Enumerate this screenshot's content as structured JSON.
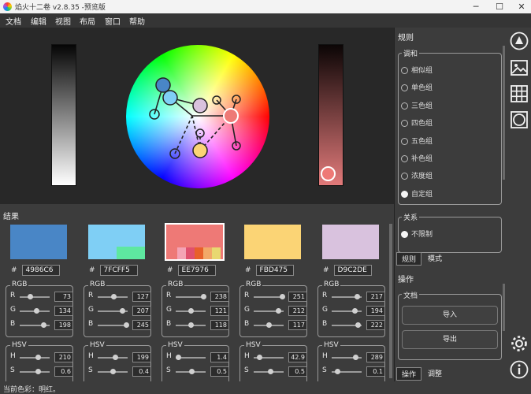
{
  "window": {
    "title": "焰火十二卷 v2.8.35 -预览版",
    "minimize": "─",
    "maximize": "☐",
    "close": "✕"
  },
  "menu": [
    "文档",
    "编辑",
    "视图",
    "布局",
    "窗口",
    "帮助"
  ],
  "results": {
    "title": "结果",
    "hash": "#",
    "swatches": [
      {
        "hex": "4986C6",
        "color": "#4986C6"
      },
      {
        "hex": "7FCFF5",
        "color": "#7FCFF5",
        "accent": "#5EE8A0"
      },
      {
        "hex": "EE7976",
        "color": "#EE7976",
        "strip": [
          "#F4A3B5",
          "#E0506E",
          "#E8602A",
          "#F2A868",
          "#E8D870"
        ]
      },
      {
        "hex": "FBD475",
        "color": "#FBD475"
      },
      {
        "hex": "D9C2DE",
        "color": "#D9C2DE"
      }
    ],
    "rgb_title": "RGB",
    "hsv_title": "HSV",
    "rgb_labels": [
      "R",
      "G",
      "B"
    ],
    "hsv_labels": [
      "H",
      "S"
    ],
    "rgb_values": [
      [
        "73",
        "134",
        "198"
      ],
      [
        "127",
        "207",
        "245"
      ],
      [
        "238",
        "121",
        "118"
      ],
      [
        "251",
        "212",
        "117"
      ],
      [
        "217",
        "194",
        "222"
      ]
    ],
    "rgb_levels": [
      [
        0.29,
        0.53,
        0.78
      ],
      [
        0.5,
        0.81,
        0.96
      ],
      [
        0.93,
        0.47,
        0.46
      ],
      [
        0.98,
        0.83,
        0.46
      ],
      [
        0.85,
        0.76,
        0.87
      ]
    ],
    "hsv_values": [
      [
        "210",
        "0.6"
      ],
      [
        "199",
        "0.4"
      ],
      [
        "1.4",
        "0.5"
      ],
      [
        "42.9",
        "0.5"
      ],
      [
        "289",
        "0.1"
      ]
    ],
    "hsv_levels": [
      [
        0.58,
        0.6
      ],
      [
        0.55,
        0.48
      ],
      [
        0.004,
        0.5
      ],
      [
        0.12,
        0.53
      ],
      [
        0.8,
        0.13
      ]
    ]
  },
  "right_panel": {
    "rules_title": "规则",
    "harmony_title": "调和",
    "harmony_options": [
      {
        "label": "相似组",
        "selected": false
      },
      {
        "label": "单色组",
        "selected": false
      },
      {
        "label": "三色组",
        "selected": false
      },
      {
        "label": "四色组",
        "selected": false
      },
      {
        "label": "五色组",
        "selected": false
      },
      {
        "label": "补色组",
        "selected": false
      },
      {
        "label": "浓度组",
        "selected": false
      },
      {
        "label": "自定组",
        "selected": true
      }
    ],
    "relation_title": "关系",
    "relation_options": [
      {
        "label": "不限制",
        "selected": true
      }
    ],
    "tabs_top": [
      {
        "label": "规则",
        "active": true
      },
      {
        "label": "模式",
        "active": false
      }
    ],
    "ops_title": "操作",
    "doc_title": "文档",
    "import_label": "导入",
    "export_label": "导出",
    "tabs_bottom": [
      {
        "label": "操作",
        "active": true
      },
      {
        "label": "调整",
        "active": false
      }
    ]
  },
  "toolbar": {
    "icons": [
      "wheel-mode-icon",
      "image-icon",
      "grid-icon",
      "composite-icon",
      "settings-icon",
      "info-icon"
    ]
  },
  "status": {
    "text": "当前色彩：明红。"
  }
}
